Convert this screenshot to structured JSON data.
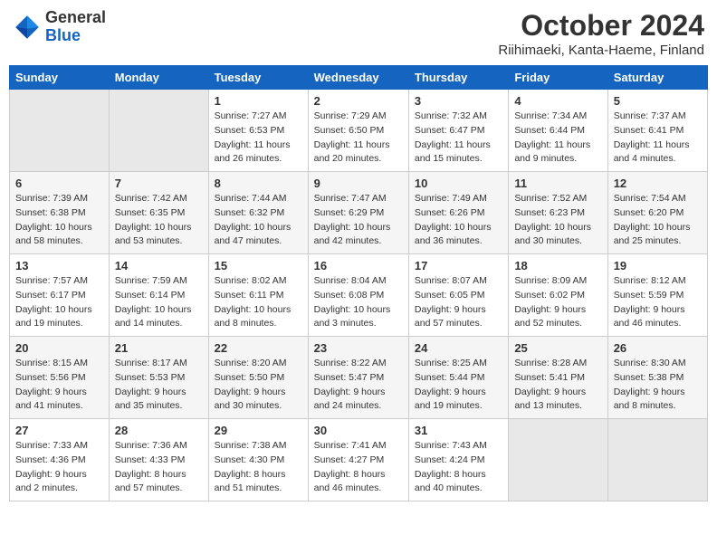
{
  "header": {
    "logo_general": "General",
    "logo_blue": "Blue",
    "month_title": "October 2024",
    "location": "Riihimaeki, Kanta-Haeme, Finland"
  },
  "weekdays": [
    "Sunday",
    "Monday",
    "Tuesday",
    "Wednesday",
    "Thursday",
    "Friday",
    "Saturday"
  ],
  "weeks": [
    [
      {
        "day": "",
        "sunrise": "",
        "sunset": "",
        "daylight": ""
      },
      {
        "day": "",
        "sunrise": "",
        "sunset": "",
        "daylight": ""
      },
      {
        "day": "1",
        "sunrise": "Sunrise: 7:27 AM",
        "sunset": "Sunset: 6:53 PM",
        "daylight": "Daylight: 11 hours and 26 minutes."
      },
      {
        "day": "2",
        "sunrise": "Sunrise: 7:29 AM",
        "sunset": "Sunset: 6:50 PM",
        "daylight": "Daylight: 11 hours and 20 minutes."
      },
      {
        "day": "3",
        "sunrise": "Sunrise: 7:32 AM",
        "sunset": "Sunset: 6:47 PM",
        "daylight": "Daylight: 11 hours and 15 minutes."
      },
      {
        "day": "4",
        "sunrise": "Sunrise: 7:34 AM",
        "sunset": "Sunset: 6:44 PM",
        "daylight": "Daylight: 11 hours and 9 minutes."
      },
      {
        "day": "5",
        "sunrise": "Sunrise: 7:37 AM",
        "sunset": "Sunset: 6:41 PM",
        "daylight": "Daylight: 11 hours and 4 minutes."
      }
    ],
    [
      {
        "day": "6",
        "sunrise": "Sunrise: 7:39 AM",
        "sunset": "Sunset: 6:38 PM",
        "daylight": "Daylight: 10 hours and 58 minutes."
      },
      {
        "day": "7",
        "sunrise": "Sunrise: 7:42 AM",
        "sunset": "Sunset: 6:35 PM",
        "daylight": "Daylight: 10 hours and 53 minutes."
      },
      {
        "day": "8",
        "sunrise": "Sunrise: 7:44 AM",
        "sunset": "Sunset: 6:32 PM",
        "daylight": "Daylight: 10 hours and 47 minutes."
      },
      {
        "day": "9",
        "sunrise": "Sunrise: 7:47 AM",
        "sunset": "Sunset: 6:29 PM",
        "daylight": "Daylight: 10 hours and 42 minutes."
      },
      {
        "day": "10",
        "sunrise": "Sunrise: 7:49 AM",
        "sunset": "Sunset: 6:26 PM",
        "daylight": "Daylight: 10 hours and 36 minutes."
      },
      {
        "day": "11",
        "sunrise": "Sunrise: 7:52 AM",
        "sunset": "Sunset: 6:23 PM",
        "daylight": "Daylight: 10 hours and 30 minutes."
      },
      {
        "day": "12",
        "sunrise": "Sunrise: 7:54 AM",
        "sunset": "Sunset: 6:20 PM",
        "daylight": "Daylight: 10 hours and 25 minutes."
      }
    ],
    [
      {
        "day": "13",
        "sunrise": "Sunrise: 7:57 AM",
        "sunset": "Sunset: 6:17 PM",
        "daylight": "Daylight: 10 hours and 19 minutes."
      },
      {
        "day": "14",
        "sunrise": "Sunrise: 7:59 AM",
        "sunset": "Sunset: 6:14 PM",
        "daylight": "Daylight: 10 hours and 14 minutes."
      },
      {
        "day": "15",
        "sunrise": "Sunrise: 8:02 AM",
        "sunset": "Sunset: 6:11 PM",
        "daylight": "Daylight: 10 hours and 8 minutes."
      },
      {
        "day": "16",
        "sunrise": "Sunrise: 8:04 AM",
        "sunset": "Sunset: 6:08 PM",
        "daylight": "Daylight: 10 hours and 3 minutes."
      },
      {
        "day": "17",
        "sunrise": "Sunrise: 8:07 AM",
        "sunset": "Sunset: 6:05 PM",
        "daylight": "Daylight: 9 hours and 57 minutes."
      },
      {
        "day": "18",
        "sunrise": "Sunrise: 8:09 AM",
        "sunset": "Sunset: 6:02 PM",
        "daylight": "Daylight: 9 hours and 52 minutes."
      },
      {
        "day": "19",
        "sunrise": "Sunrise: 8:12 AM",
        "sunset": "Sunset: 5:59 PM",
        "daylight": "Daylight: 9 hours and 46 minutes."
      }
    ],
    [
      {
        "day": "20",
        "sunrise": "Sunrise: 8:15 AM",
        "sunset": "Sunset: 5:56 PM",
        "daylight": "Daylight: 9 hours and 41 minutes."
      },
      {
        "day": "21",
        "sunrise": "Sunrise: 8:17 AM",
        "sunset": "Sunset: 5:53 PM",
        "daylight": "Daylight: 9 hours and 35 minutes."
      },
      {
        "day": "22",
        "sunrise": "Sunrise: 8:20 AM",
        "sunset": "Sunset: 5:50 PM",
        "daylight": "Daylight: 9 hours and 30 minutes."
      },
      {
        "day": "23",
        "sunrise": "Sunrise: 8:22 AM",
        "sunset": "Sunset: 5:47 PM",
        "daylight": "Daylight: 9 hours and 24 minutes."
      },
      {
        "day": "24",
        "sunrise": "Sunrise: 8:25 AM",
        "sunset": "Sunset: 5:44 PM",
        "daylight": "Daylight: 9 hours and 19 minutes."
      },
      {
        "day": "25",
        "sunrise": "Sunrise: 8:28 AM",
        "sunset": "Sunset: 5:41 PM",
        "daylight": "Daylight: 9 hours and 13 minutes."
      },
      {
        "day": "26",
        "sunrise": "Sunrise: 8:30 AM",
        "sunset": "Sunset: 5:38 PM",
        "daylight": "Daylight: 9 hours and 8 minutes."
      }
    ],
    [
      {
        "day": "27",
        "sunrise": "Sunrise: 7:33 AM",
        "sunset": "Sunset: 4:36 PM",
        "daylight": "Daylight: 9 hours and 2 minutes."
      },
      {
        "day": "28",
        "sunrise": "Sunrise: 7:36 AM",
        "sunset": "Sunset: 4:33 PM",
        "daylight": "Daylight: 8 hours and 57 minutes."
      },
      {
        "day": "29",
        "sunrise": "Sunrise: 7:38 AM",
        "sunset": "Sunset: 4:30 PM",
        "daylight": "Daylight: 8 hours and 51 minutes."
      },
      {
        "day": "30",
        "sunrise": "Sunrise: 7:41 AM",
        "sunset": "Sunset: 4:27 PM",
        "daylight": "Daylight: 8 hours and 46 minutes."
      },
      {
        "day": "31",
        "sunrise": "Sunrise: 7:43 AM",
        "sunset": "Sunset: 4:24 PM",
        "daylight": "Daylight: 8 hours and 40 minutes."
      },
      {
        "day": "",
        "sunrise": "",
        "sunset": "",
        "daylight": ""
      },
      {
        "day": "",
        "sunrise": "",
        "sunset": "",
        "daylight": ""
      }
    ]
  ]
}
